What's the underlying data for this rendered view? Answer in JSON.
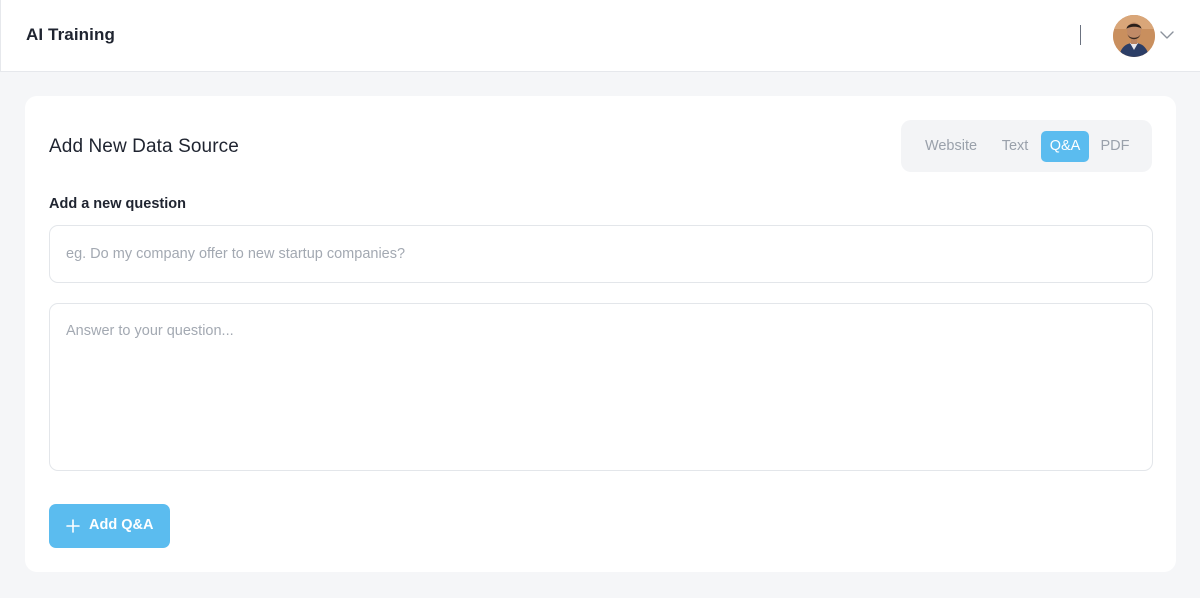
{
  "header": {
    "title": "AI Training",
    "avatar_icon": "user-avatar",
    "menu_icon": "chevron-down-icon"
  },
  "card": {
    "title": "Add New Data Source",
    "tabs": [
      {
        "label": "Website",
        "active": false
      },
      {
        "label": "Text",
        "active": false
      },
      {
        "label": "Q&A",
        "active": true
      },
      {
        "label": "PDF",
        "active": false
      }
    ],
    "question_label": "Add a new question",
    "question_placeholder": "eg. Do my company offer to new startup companies?",
    "question_value": "",
    "answer_placeholder": "Answer to your question...",
    "answer_value": "",
    "add_button_label": "Add Q&A",
    "add_button_icon": "plus-icon"
  },
  "colors": {
    "accent": "#5bbcef",
    "background": "#f5f6f8",
    "card": "#ffffff",
    "text": "#1f2430",
    "muted": "#9aa1ab"
  }
}
